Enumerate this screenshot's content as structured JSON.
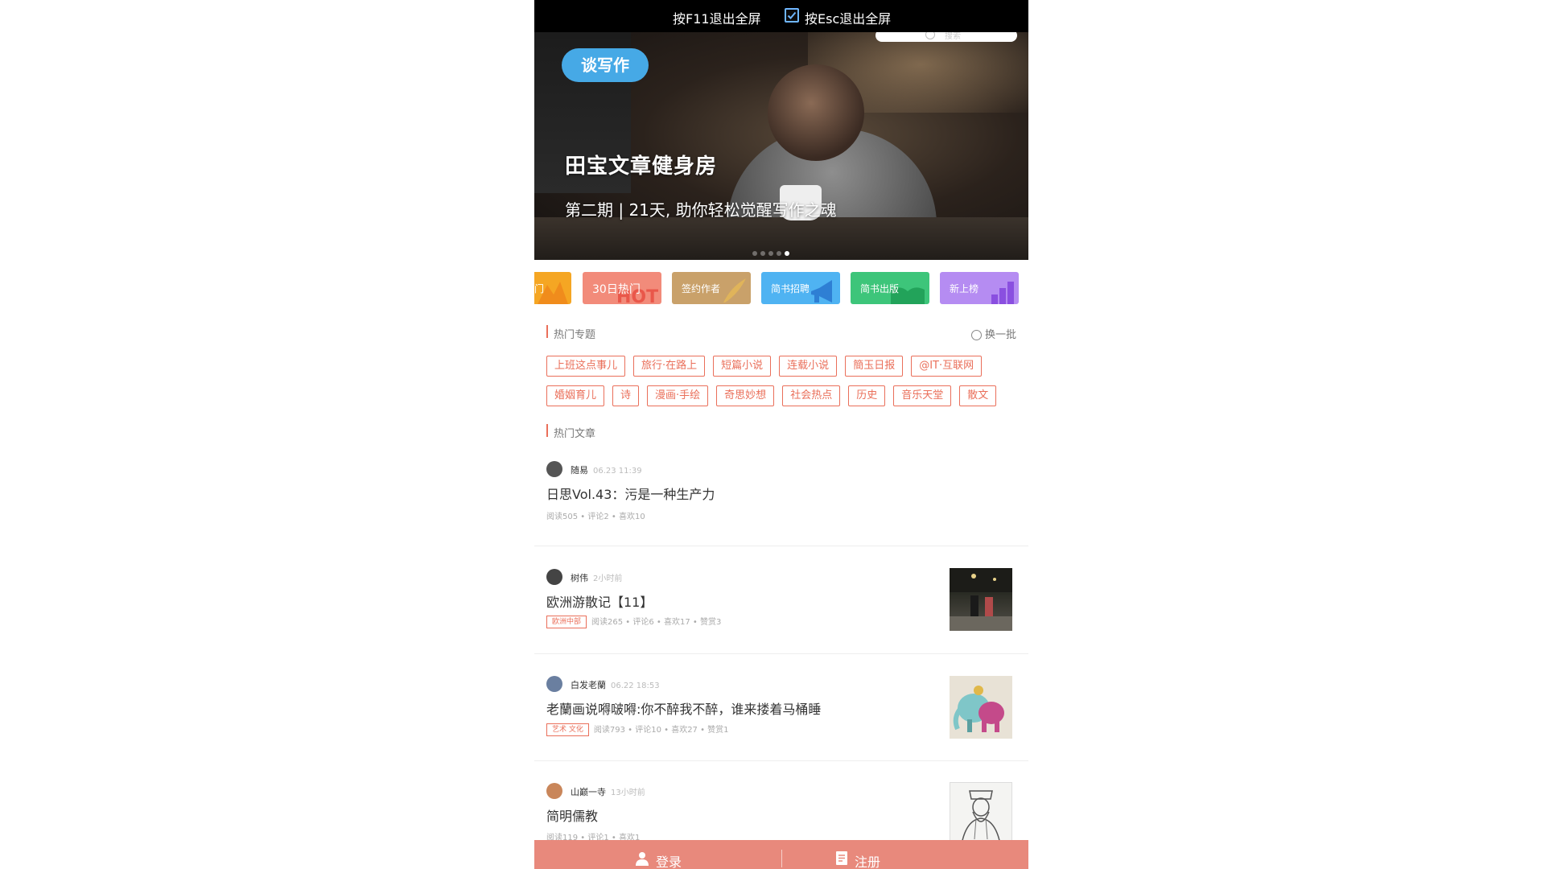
{
  "topbar": {
    "f11_text": "按F11退出全屏",
    "esc_text": "按Esc退出全屏",
    "esc_checked": true
  },
  "banner": {
    "search_placeholder": "搜索",
    "badge": "谈写作",
    "title": "田宝文章健身房",
    "subtitle": "第二期 | 21天, 助你轻松觉醒写作之魂",
    "dots_count": 5,
    "active_dot": 4
  },
  "categories": [
    {
      "label": "门",
      "color": "#f5a623",
      "icon": "mountain-icon"
    },
    {
      "label": "30日热门",
      "color": "#f28b7a",
      "icon": "hot-icon"
    },
    {
      "label": "签约作者",
      "color": "#c9a16a",
      "icon": "quill-icon"
    },
    {
      "label": "简书招聘",
      "color": "#4fb3f2",
      "icon": "megaphone-icon"
    },
    {
      "label": "简书出版",
      "color": "#3dc57a",
      "icon": "book-icon"
    },
    {
      "label": "新上榜",
      "color": "#b58cf2",
      "icon": "bars-icon"
    }
  ],
  "hot_topics": {
    "title": "热门专题",
    "refresh": "换一批",
    "row1": [
      "上班这点事儿",
      "旅行·在路上",
      "短篇小说",
      "连载小说",
      "簡玉日报",
      "@IT·互联网"
    ],
    "row2": [
      "婚姻育儿",
      "诗",
      "漫画·手绘",
      "奇思妙想",
      "社会热点",
      "历史",
      "音乐天堂",
      "散文"
    ]
  },
  "hot_articles": {
    "title": "热门文章",
    "items": [
      {
        "author": "随易",
        "time": "06.23 11:39",
        "title": "日思Vol.43：污是一种生产力",
        "tag": "",
        "stats": "阅读505 • 评论2 • 喜欢10",
        "has_thumb": false,
        "avatar_color": "#555"
      },
      {
        "author": "树伟",
        "time": "2小时前",
        "title": "欧洲游散记【11】",
        "tag": "欧洲中部",
        "stats": "阅读265 • 评论6 • 喜欢17 • 赞赏3",
        "has_thumb": true,
        "thumb_type": "street",
        "avatar_color": "#444"
      },
      {
        "author": "白发老蘭",
        "time": "06.22 18:53",
        "title": "老蘭画说嘚啵嘚:你不醉我不醉，谁来搂着马桶睡",
        "tag": "艺术 文化",
        "stats": "阅读793 • 评论10 • 喜欢27 • 赞赏1",
        "has_thumb": true,
        "thumb_type": "elephant",
        "avatar_color": "#6a7fa0"
      },
      {
        "author": "山巅一寺",
        "time": "13小时前",
        "title": "简明儒教",
        "tag": "",
        "stats": "阅读119 • 评论1 • 喜欢1",
        "has_thumb": true,
        "thumb_type": "sketch",
        "avatar_color": "#c9865a"
      }
    ]
  },
  "bottom_bar": {
    "login": "登录",
    "register": "注册",
    "bg": "#e8897c"
  }
}
